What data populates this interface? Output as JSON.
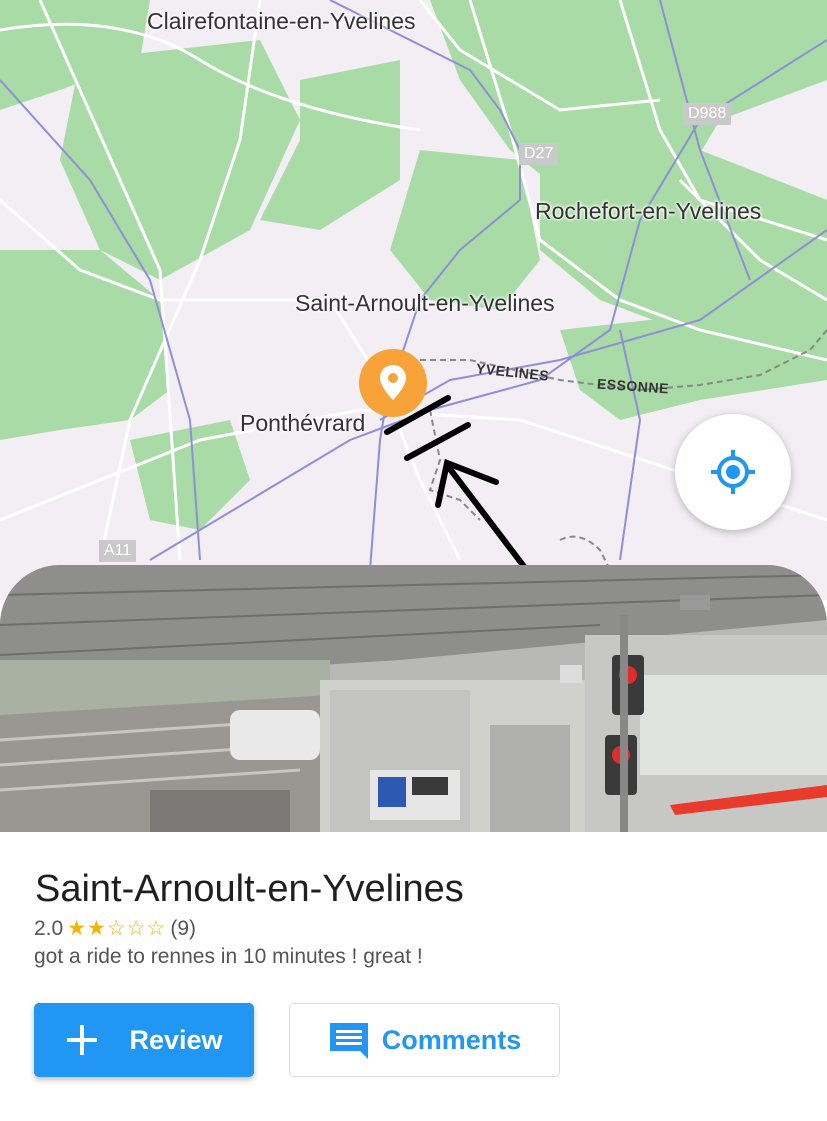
{
  "map": {
    "places": {
      "clairefontaine": "Clairefontaine-en-Yvelines",
      "rochefort": "Rochefort-en-Yvelines",
      "saint_arnoult": "Saint-Arnoult-en-Yvelines",
      "ponthevrard": "Ponthévrard"
    },
    "roads": {
      "d988": "D988",
      "d27": "D27",
      "a11": "A11"
    },
    "regions": {
      "yvelines": "YVELINES",
      "essonne": "ESSONNE"
    },
    "pin_icon": "map-pin-icon",
    "locate_icon": "my-location-icon",
    "colors": {
      "park": "#a9dba6",
      "land": "#f2eef4",
      "road": "#8f8fd6",
      "pin": "#f7a33a",
      "accent": "#2196f3"
    }
  },
  "place": {
    "title": "Saint-Arnoult-en-Yvelines",
    "rating": "2.0",
    "stars": "★★☆☆☆",
    "review_count": "(9)",
    "comment": "got a ride to rennes in 10 minutes ! great !"
  },
  "actions": {
    "review_label": "Review",
    "comments_label": "Comments"
  }
}
